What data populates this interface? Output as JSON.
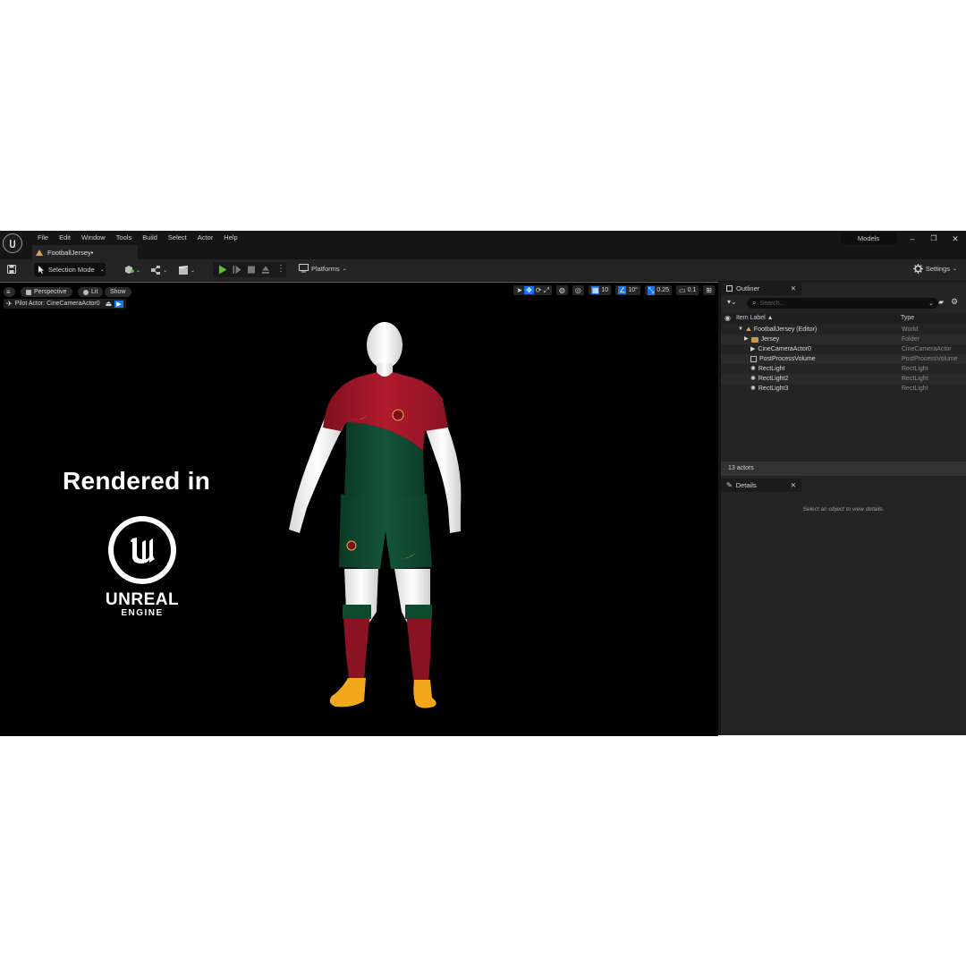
{
  "menu": {
    "items": [
      "File",
      "Edit",
      "Window",
      "Tools",
      "Build",
      "Select",
      "Actor",
      "Help"
    ]
  },
  "document_tab": {
    "label": "FootballJersey•"
  },
  "title_right": {
    "models_label": "Models",
    "minimize": "–",
    "restore": "❐",
    "close": "✕"
  },
  "toolbar": {
    "selection_mode": "Selection Mode",
    "platforms": "Platforms",
    "settings": "Settings"
  },
  "viewport": {
    "perspective": "Perspective",
    "lit": "Lit",
    "show": "Show",
    "grid_snap": "10",
    "rotation_snap": "10°",
    "scale_snap": "0.25",
    "camera_speed": "0.1",
    "pilot_actor": "Pilot Actor: CineCameraActor0",
    "overlay_title": "Rendered in",
    "watermark_line1": "UNREAL",
    "watermark_line2": "ENGINE"
  },
  "outliner": {
    "tab_label": "Outliner",
    "close": "✕",
    "search_placeholder": "Search...",
    "col_label": "Item Label ▲",
    "col_type": "Type",
    "rows": [
      {
        "label": "FootballJersey (Editor)",
        "type": "World"
      },
      {
        "label": "Jersey",
        "type": "Folder"
      },
      {
        "label": "CineCameraActor0",
        "type": "CineCameraActor"
      },
      {
        "label": "PostProcessVolume",
        "type": "PostProcessVolume"
      },
      {
        "label": "RectLight",
        "type": "RectLight"
      },
      {
        "label": "RectLight2",
        "type": "RectLight"
      },
      {
        "label": "RectLight3",
        "type": "RectLight"
      }
    ],
    "actor_count": "13 actors"
  },
  "details": {
    "tab_label": "Details",
    "close": "✕",
    "hint": "Select an object to view details."
  },
  "colors": {
    "accent": "#1a73e8",
    "play_green": "#5fbf3a",
    "shirt_red": "#a3162a",
    "shirt_green": "#0f4a2e",
    "boots": "#f2a81a"
  }
}
